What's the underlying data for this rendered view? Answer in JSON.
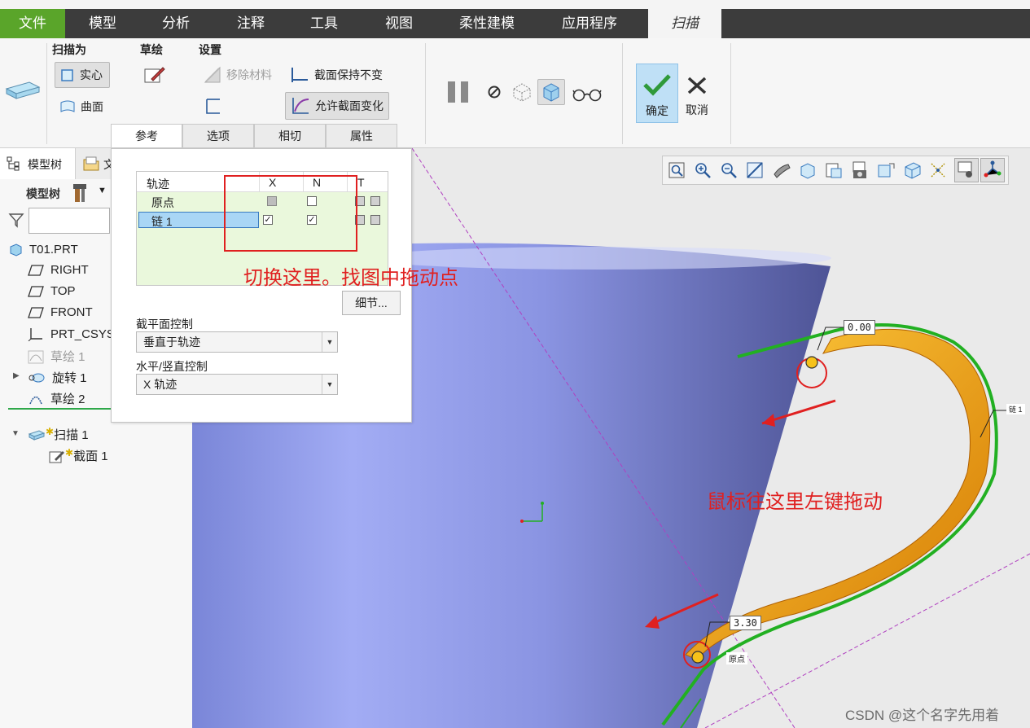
{
  "menu": {
    "file": "文件",
    "tabs": [
      "模型",
      "分析",
      "注释",
      "工具",
      "视图",
      "柔性建模",
      "应用程序"
    ],
    "active_tab": "扫描"
  },
  "ribbon": {
    "sweep_as": {
      "label": "扫描为",
      "solid": "实心",
      "surface": "曲面"
    },
    "sketch": {
      "label": "草绘"
    },
    "settings": {
      "label": "设置",
      "remove_material": "移除材料",
      "constant_section": "截面保持不变",
      "variable_section": "允许截面变化"
    },
    "ok": "确定",
    "cancel": "取消"
  },
  "subtabs": [
    "参考",
    "选项",
    "相切",
    "属性"
  ],
  "panel": {
    "table_headers": {
      "trajectory": "轨迹",
      "x": "X",
      "n": "N",
      "t": "T"
    },
    "rows": [
      {
        "name": "原点",
        "x": "grey",
        "n": false
      },
      {
        "name": "链 1",
        "x": true,
        "n": true
      }
    ],
    "details_button": "细节...",
    "section_plane_label": "截平面控制",
    "section_plane_value": "垂直于轨迹",
    "hv_control_label": "水平/竖直控制",
    "hv_control_value": "X 轨迹"
  },
  "left": {
    "tabs": {
      "model_tree": "模型树",
      "folder": "文"
    },
    "tree_label": "模型树",
    "items": [
      {
        "label": "T01.PRT",
        "icon": "part-icon"
      },
      {
        "label": "RIGHT",
        "icon": "plane-icon"
      },
      {
        "label": "TOP",
        "icon": "plane-icon"
      },
      {
        "label": "FRONT",
        "icon": "plane-icon"
      },
      {
        "label": "PRT_CSYS_",
        "icon": "csys-icon"
      },
      {
        "label": "草绘 1",
        "icon": "sketch-icon"
      },
      {
        "label": "旋转 1",
        "icon": "revolve-icon"
      },
      {
        "label": "草绘 2",
        "icon": "sketch-icon"
      },
      {
        "label": "扫描 1",
        "icon": "sweep-icon"
      },
      {
        "label": "截面 1",
        "icon": "section-icon"
      }
    ]
  },
  "annotations": {
    "switch_here": "切换这里。找图中拖动点",
    "drag_here": "鼠标往这里左键拖动",
    "dim_top": "0.00",
    "dim_bottom": "3.30",
    "chain_label": "链 1",
    "origin_label": "原点"
  },
  "watermark": "CSDN @这个名字先用着",
  "colors": {
    "accent_green": "#5aa52a",
    "annotation_red": "#e02020",
    "handle_orange": "#f0a000",
    "trajectory_green": "#22b022",
    "cup_blue": "#8c96e6"
  }
}
